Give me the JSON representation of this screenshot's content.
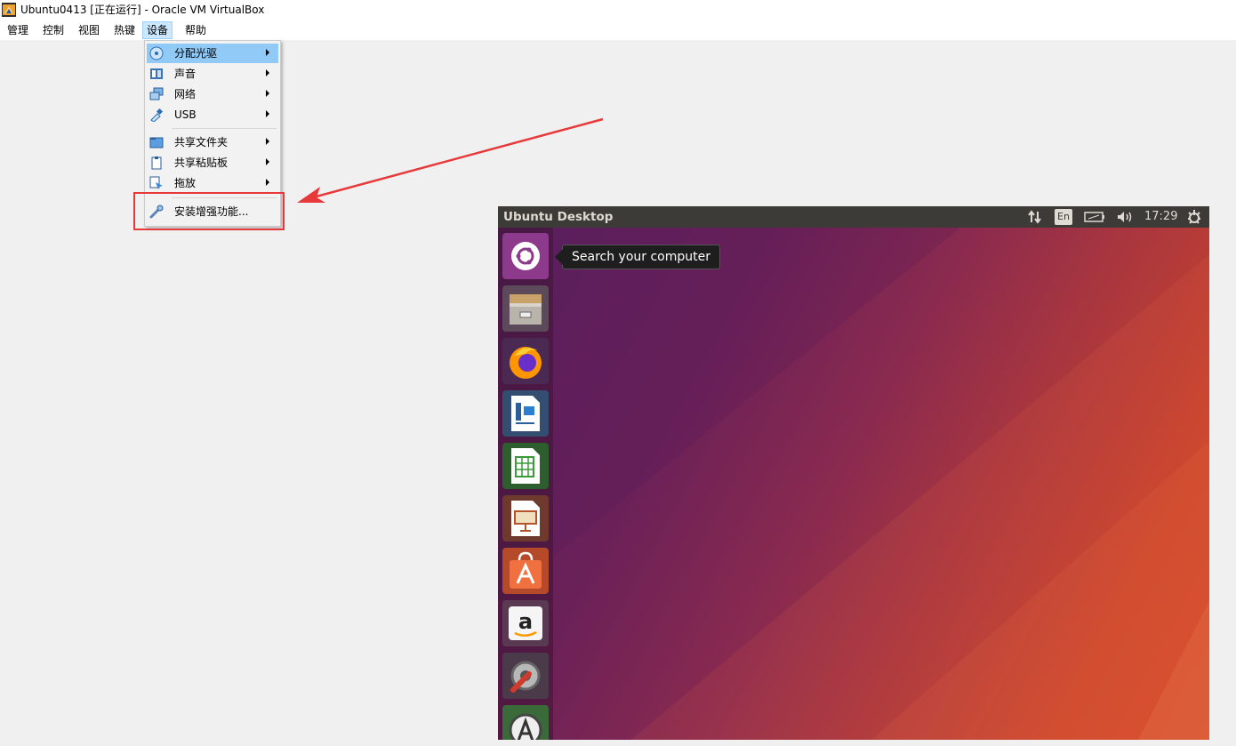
{
  "window": {
    "title": "Ubuntu0413 [正在运行] - Oracle VM VirtualBox",
    "app_icon": "virtualbox-icon"
  },
  "menubar": {
    "items": [
      {
        "label": "管理"
      },
      {
        "label": "控制"
      },
      {
        "label": "视图"
      },
      {
        "label": "热键"
      },
      {
        "label": "设备"
      },
      {
        "label": "帮助"
      }
    ],
    "active": "设备"
  },
  "devices_menu": {
    "items": [
      {
        "label": "分配光驱",
        "icon": "optical-disc-icon",
        "submenu": true,
        "highlighted": true
      },
      {
        "label": "声音",
        "icon": "audio-icon",
        "submenu": true
      },
      {
        "label": "网络",
        "icon": "network-icon",
        "submenu": true
      },
      {
        "label": "USB",
        "icon": "usb-icon",
        "submenu": true
      },
      {
        "label": "共享文件夹",
        "icon": "shared-folder-icon",
        "submenu": true
      },
      {
        "label": "共享粘贴板",
        "icon": "clipboard-icon",
        "submenu": true
      },
      {
        "label": "拖放",
        "icon": "drag-drop-icon",
        "submenu": true
      },
      {
        "label": "安装增强功能...",
        "icon": "guest-additions-icon",
        "submenu": false
      }
    ],
    "highlight_color": "#e8393a"
  },
  "ubuntu": {
    "panel_title": "Ubuntu Desktop",
    "lang": "En",
    "time": "17:29",
    "tooltip": "Search your computer",
    "launcher_items": [
      "ubuntu-dash-icon",
      "files-icon",
      "firefox-icon",
      "libreoffice-writer-icon",
      "libreoffice-calc-icon",
      "libreoffice-impress-icon",
      "ubuntu-software-icon",
      "amazon-icon",
      "system-settings-icon",
      "software-updater-icon"
    ]
  }
}
